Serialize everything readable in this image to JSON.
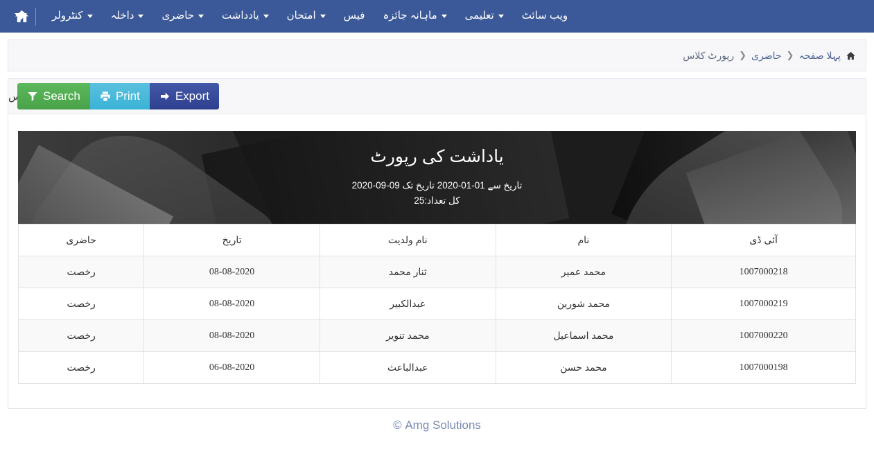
{
  "navbar": {
    "home_icon": "home-icon",
    "toggle_icon": "caret-down-icon",
    "items": [
      {
        "label": "کنٹرولر",
        "has_caret": true
      },
      {
        "label": "داخلہ",
        "has_caret": true
      },
      {
        "label": "حاضری",
        "has_caret": true
      },
      {
        "label": "یادداشت",
        "has_caret": true
      },
      {
        "label": "امتحان",
        "has_caret": true
      },
      {
        "label": "فیس",
        "has_caret": false
      },
      {
        "label": "ماہانہ جائزہ",
        "has_caret": true
      },
      {
        "label": "تعلیمی",
        "has_caret": true
      },
      {
        "label": "ویب سائٹ",
        "has_caret": false
      }
    ]
  },
  "breadcrumb": {
    "home_icon": "home-icon",
    "items": [
      "پہلا صفحہ",
      "حاضری",
      "رپورٹ کلاس"
    ],
    "separator": "❮"
  },
  "toolbar": {
    "title": "رپورٹ کلاس",
    "search_label": "Search",
    "print_label": "Print",
    "export_label": "Export",
    "search_icon": "filter-icon",
    "print_icon": "printer-icon",
    "export_icon": "arrow-right-icon"
  },
  "report": {
    "title": "یاداشت کی رپورٹ",
    "date_range": "تاریخ سے 01-01-2020 تاریخ تک 09-09-2020",
    "total": "کل تعداد:25"
  },
  "table": {
    "headers": [
      "آئی ڈی",
      "نام",
      "نام ولدیت",
      "تاریخ",
      "حاضری"
    ],
    "rows": [
      {
        "id": "1007000218",
        "name": "محمد عمیر",
        "father": "ثنار محمد",
        "date": "08-08-2020",
        "attendance": "رخصت"
      },
      {
        "id": "1007000219",
        "name": "محمد شورین",
        "father": "عبدالکبیر",
        "date": "08-08-2020",
        "attendance": "رخصت"
      },
      {
        "id": "1007000220",
        "name": "محمد اسماعیل",
        "father": "محمد تنویر",
        "date": "08-08-2020",
        "attendance": "رخصت"
      },
      {
        "id": "1007000198",
        "name": "محمد حسن",
        "father": "عبدالباعث",
        "date": "06-08-2020",
        "attendance": "رخصت"
      }
    ]
  },
  "footer": {
    "text": "Amg Solutions ©"
  },
  "colors": {
    "navbar": "#3b5998",
    "search": "#5cb85c",
    "print": "#5bc0de",
    "export": "#364a9e",
    "banner": "#1c1c1c",
    "footer_text": "#7a8ab0"
  }
}
